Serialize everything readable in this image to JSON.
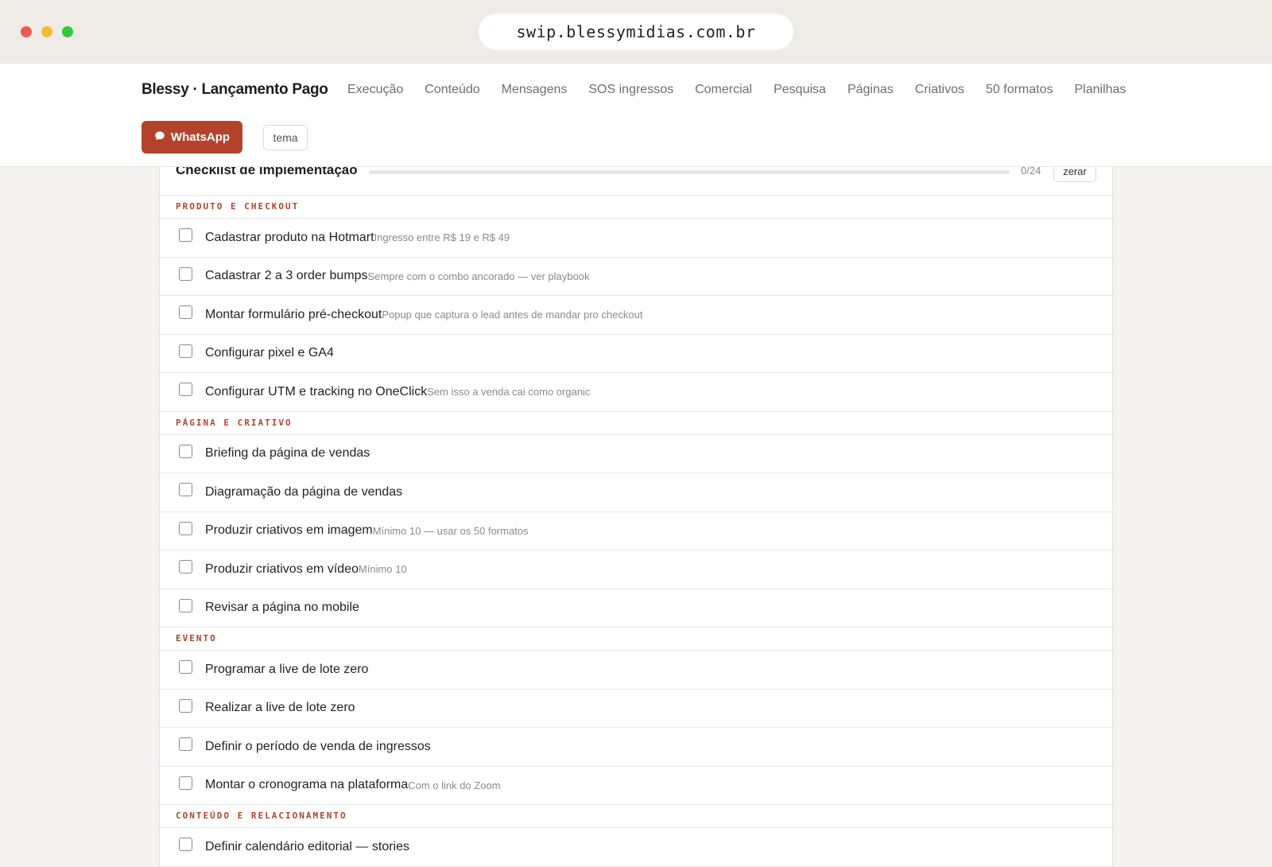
{
  "browser": {
    "url": "swip.blessymidias.com.br"
  },
  "header": {
    "brand": "Blessy · Lançamento Pago",
    "nav": [
      {
        "label": "Execução"
      },
      {
        "label": "Conteúdo"
      },
      {
        "label": "Mensagens"
      },
      {
        "label": "SOS ingressos"
      },
      {
        "label": "Comercial"
      },
      {
        "label": "Pesquisa"
      },
      {
        "label": "Páginas"
      },
      {
        "label": "Criativos"
      },
      {
        "label": "50 formatos"
      },
      {
        "label": "Planilhas"
      }
    ],
    "whatsapp_label": "WhatsApp",
    "whatsapp_icon": "chat-bubble-icon",
    "theme_label": "tema"
  },
  "checklist": {
    "title": "Checklist de implementação",
    "progress_count": "0/24",
    "progress_fraction": 0,
    "reset_label": "zerar",
    "sections": [
      {
        "title": "PRODUTO E CHECKOUT",
        "items": [
          {
            "label": "Cadastrar produto na Hotmart",
            "note": "Ingresso entre R$ 19 e R$ 49"
          },
          {
            "label": "Cadastrar 2 a 3 order bumps",
            "note": "Sempre com o combo ancorado — ver playbook"
          },
          {
            "label": "Montar formulário pré-checkout",
            "note": "Popup que captura o lead antes de mandar pro checkout"
          },
          {
            "label": "Configurar pixel e GA4",
            "note": ""
          },
          {
            "label": "Configurar UTM e tracking no OneClick",
            "note": "Sem isso a venda cai como organic"
          }
        ]
      },
      {
        "title": "PÁGINA E CRIATIVO",
        "items": [
          {
            "label": "Briefing da página de vendas",
            "note": ""
          },
          {
            "label": "Diagramação da página de vendas",
            "note": ""
          },
          {
            "label": "Produzir criativos em imagem",
            "note": "Mínimo 10 — usar os 50 formatos"
          },
          {
            "label": "Produzir criativos em vídeo",
            "note": "Mínimo 10"
          },
          {
            "label": "Revisar a página no mobile",
            "note": ""
          }
        ]
      },
      {
        "title": "EVENTO",
        "items": [
          {
            "label": "Programar a live de lote zero",
            "note": ""
          },
          {
            "label": "Realizar a live de lote zero",
            "note": ""
          },
          {
            "label": "Definir o período de venda de ingressos",
            "note": ""
          },
          {
            "label": "Montar o cronograma na plataforma",
            "note": "Com o link do Zoom"
          }
        ]
      },
      {
        "title": "CONTEÚDO E RELACIONAMENTO",
        "items": [
          {
            "label": "Definir calendário editorial — stories",
            "note": ""
          }
        ]
      }
    ]
  }
}
